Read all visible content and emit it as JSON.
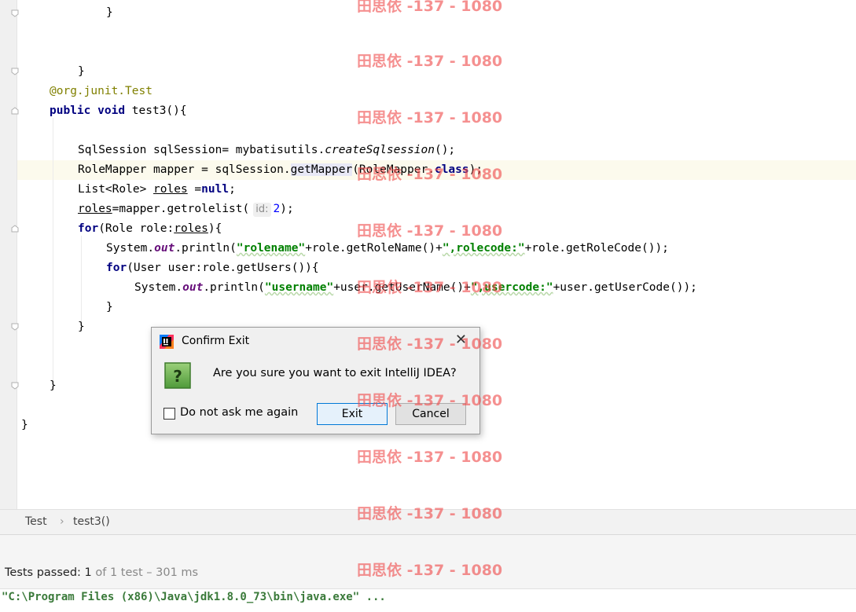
{
  "code_lines": [
    "}",
    "}",
    "@org.junit.Test",
    "public void test3(){",
    "SqlSession sqlSession= mybatisutils.createSqlsession();",
    "RoleMapper mapper = sqlSession.getMapper(RoleMapper.class);",
    "List<Role> roles =null;",
    "roles=mapper.getrolelist( id: 2);",
    "for(Role role:roles){",
    "System.out.println(\"rolename\"+role.getRoleName()+\",rolecode:\"+role.getRoleCode());",
    "for(User user:role.getUsers()){",
    "System.out.println(\"username\"+user.getUserName()+\",usercode:\"+user.getUserCode());",
    "}",
    "}",
    "}",
    "}"
  ],
  "param_hint": "id:",
  "watermark": "田思依 -137 - 1080",
  "breadcrumb": {
    "class_name": "Test",
    "separator": "›",
    "method_name": "test3()"
  },
  "tests": {
    "prefix": "Tests passed: ",
    "passed": "1",
    "rest": " of 1 test – 301 ms"
  },
  "console_line": "\"C:\\Program Files (x86)\\Java\\jdk1.8.0_73\\bin\\java.exe\" ...",
  "dialog": {
    "title": "Confirm Exit",
    "message": "Are you sure you want to exit IntelliJ IDEA?",
    "checkbox_label": "Do not ask me again",
    "checkbox_checked": false,
    "exit_label": "Exit",
    "cancel_label": "Cancel",
    "close_glyph": "✕",
    "question_glyph": "?"
  },
  "colors": {
    "keyword": "#000080",
    "string": "#008000",
    "annotation": "#808000",
    "number": "#0000ff",
    "watermark": "#f04848",
    "current_line": "#fcfaed"
  }
}
